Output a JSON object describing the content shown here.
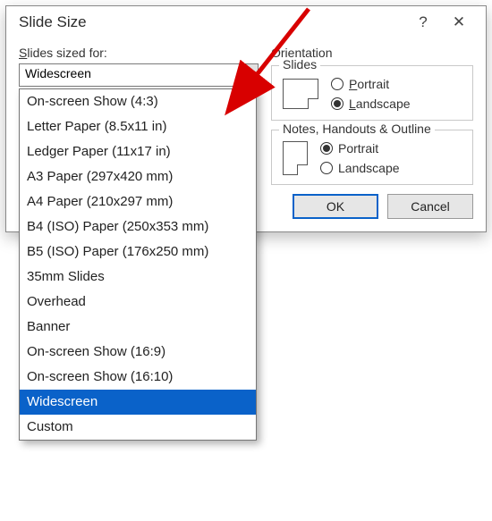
{
  "dialog": {
    "title": "Slide Size",
    "help_glyph": "?",
    "close_glyph": "✕"
  },
  "left": {
    "label_prefix": "S",
    "label_rest": "lides sized for:",
    "combo_value": "Widescreen"
  },
  "options": [
    "On-screen Show (4:3)",
    "Letter Paper (8.5x11 in)",
    "Ledger Paper (11x17 in)",
    "A3 Paper (297x420 mm)",
    "A4 Paper (210x297 mm)",
    "B4 (ISO) Paper (250x353 mm)",
    "B5 (ISO) Paper (176x250 mm)",
    "35mm Slides",
    "Overhead",
    "Banner",
    "On-screen Show (16:9)",
    "On-screen Show (16:10)",
    "Widescreen",
    "Custom"
  ],
  "selected_option_index": 12,
  "orientation": {
    "heading": "Orientation",
    "slides": {
      "title": "Slides",
      "portrait_u": "P",
      "portrait_rest": "ortrait",
      "landscape_u": "L",
      "landscape_rest": "andscape",
      "checked": "landscape"
    },
    "notes": {
      "title": "Notes, Handouts & Outline",
      "portrait_u": "P",
      "portrait_rest": "ortrait",
      "landscape_u": "L",
      "landscape_rest": "andscape",
      "checked": "portrait"
    }
  },
  "buttons": {
    "ok": "OK",
    "cancel": "Cancel"
  }
}
